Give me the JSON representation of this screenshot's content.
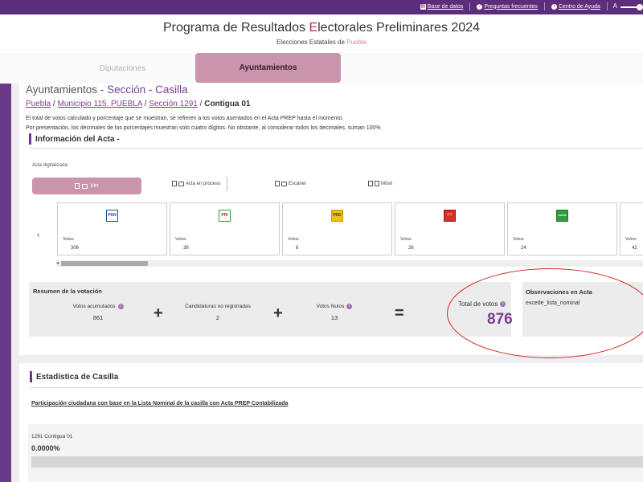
{
  "topbar": {
    "links": [
      {
        "label": "Base de datos",
        "icon": "database-icon"
      },
      {
        "label": "Preguntas frecuentes",
        "icon": "question-icon"
      },
      {
        "label": "Centro de Ayuda",
        "icon": "info-icon"
      }
    ],
    "font_size_label": "A"
  },
  "header": {
    "title_pre": "Programa de Resultados ",
    "title_accent": "E",
    "title_post": "lectorales Preliminares 2024",
    "subtitle_pre": "Elecciones Estatales de ",
    "subtitle_state": "Puebla"
  },
  "tabs": [
    {
      "label": "Diputaciones",
      "active": false
    },
    {
      "label": "Ayuntamientos",
      "active": true
    }
  ],
  "page": {
    "title_pre": "Ayuntamientos - ",
    "title_accent": "Sección - Casilla",
    "breadcrumb": {
      "items": [
        "Puebla",
        "Municipio 115. PUEBLA",
        "Sección 1291"
      ],
      "current": "Contigua 01"
    },
    "notes": [
      "El total de votos calculado y porcentaje que se muestran, se refieren a los votos asentados en el Acta PREP hasta el momento.",
      "Por presentación, los decimales de los porcentajes muestran solo cuatro dígitos. No obstante, al considerar todos los decimales, suman 100%"
    ]
  },
  "acta": {
    "section_title": "Información del Acta -",
    "digitalizada_label": "Acta digitalizada:",
    "ver_label": "Ver",
    "options": [
      "Acta en proceso",
      "Escáner",
      "Móvil"
    ]
  },
  "parties": [
    {
      "logo": "PAN",
      "color": "#1d4e9e",
      "votes_label": "Votos",
      "votes": "306"
    },
    {
      "logo": "PRI",
      "color": "#d0221c",
      "votes_label": "Votos",
      "votes": "38"
    },
    {
      "logo": "PRD",
      "color": "#f0c010",
      "votes_label": "Votos",
      "votes": "6"
    },
    {
      "logo": "PT",
      "color": "#d32f2f",
      "votes_label": "Votos",
      "votes": "26"
    },
    {
      "logo": "VERDE",
      "color": "#2e9e3c",
      "votes_label": "Votos",
      "votes": "24"
    },
    {
      "logo": "",
      "color": "#999999",
      "votes_label": "Votos",
      "votes": "42"
    }
  ],
  "summary": {
    "title": "Resumen de la votación",
    "acumulados_label": "Votos acumulados",
    "acumulados": "861",
    "no_registradas_label": "Candidaturas no registradas",
    "no_registradas": "2",
    "nulos_label": "Votos Nulos",
    "nulos": "13",
    "total_label": "Total de votos",
    "total": "876",
    "plus": "+",
    "equals": "="
  },
  "observaciones": {
    "title": "Observaciones en Acta",
    "value": "excede_lista_nominal"
  },
  "estadistica": {
    "title": "Estadística de Casilla",
    "participacion_label": "Participación ciudadana con base en la Lista Nominal de la casilla con Acta PREP Contabilizada",
    "casilla": "1291 Contigua 01",
    "percent": "0.0000%",
    "percent_value": 0
  },
  "colors": {
    "brand_purple": "#5b2d7a",
    "accent_pink": "#c994ac",
    "highlight_red": "#d62020"
  }
}
